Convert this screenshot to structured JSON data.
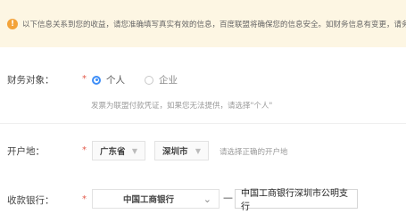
{
  "notice": {
    "icon": "warning-icon",
    "text": "以下信息关系到您的收益，请您准确填写真实有效的信息，百度联盟将确保您的信息安全。如财务信息有变更，请务必"
  },
  "finance": {
    "label": "财务对象：",
    "required_mark": "*",
    "options": [
      {
        "label": "个人",
        "checked": true
      },
      {
        "label": "企业",
        "checked": false
      }
    ],
    "hint": "发票为联盟付款凭证，如果您无法提供，请选择\"个人\""
  },
  "branch": {
    "label": "开户地：",
    "required_mark": "*",
    "province": {
      "value": "广东省",
      "caret": "▼"
    },
    "city": {
      "value": "深圳市",
      "caret": "▼"
    },
    "hint": "请选择正确的开户地"
  },
  "bank": {
    "label": "收款银行：",
    "required_mark": "*",
    "select": {
      "value": "中国工商银行",
      "caret": "⌄"
    },
    "dash": "—",
    "input_value": "中国工商银行深圳市公明支行"
  },
  "colors": {
    "accent": "#3e8ef7",
    "required": "#e35a4a",
    "notice_bg": "#fdf6e3",
    "warning": "#f3a33a"
  }
}
